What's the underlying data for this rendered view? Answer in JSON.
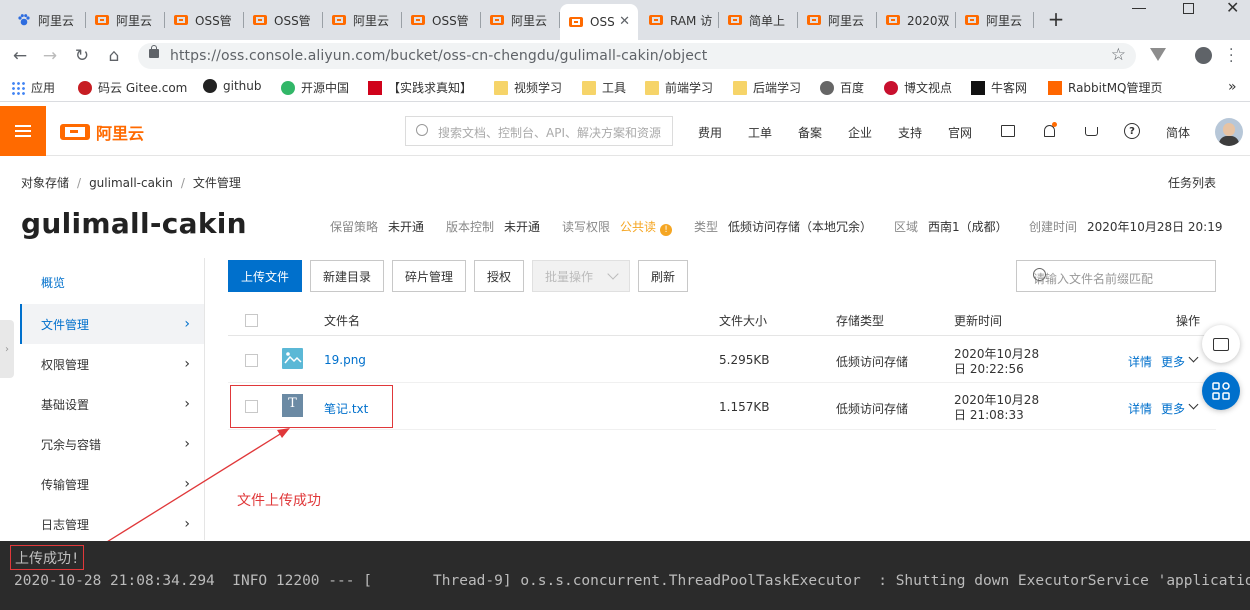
{
  "browser": {
    "tabs": [
      {
        "title": "阿里云",
        "icon": "paw-icon"
      },
      {
        "title": "阿里云",
        "icon": "aliyun-icon"
      },
      {
        "title": "OSS管",
        "icon": "aliyun-icon"
      },
      {
        "title": "OSS管",
        "icon": "aliyun-icon"
      },
      {
        "title": "阿里云",
        "icon": "aliyun-icon"
      },
      {
        "title": "OSS管",
        "icon": "aliyun-icon"
      },
      {
        "title": "阿里云",
        "icon": "aliyun-icon"
      },
      {
        "title": "OSS",
        "icon": "aliyun-icon",
        "active": true
      },
      {
        "title": "RAM 访",
        "icon": "aliyun-icon"
      },
      {
        "title": "简单上",
        "icon": "aliyun-icon"
      },
      {
        "title": "阿里云",
        "icon": "aliyun-icon"
      },
      {
        "title": "2020双",
        "icon": "aliyun-icon"
      },
      {
        "title": "阿里云",
        "icon": "aliyun-icon"
      }
    ],
    "new_tab": "+",
    "url": "https://oss.console.aliyun.com/bucket/oss-cn-chengdu/gulimall-cakin/object",
    "bookmarks": [
      {
        "label": "应用",
        "icon": "apps-icon"
      },
      {
        "label": "码云 Gitee.com",
        "icon": "gitee-icon"
      },
      {
        "label": "github",
        "icon": "github-icon"
      },
      {
        "label": "开源中国",
        "icon": "oschina-icon"
      },
      {
        "label": "【实践求真知】",
        "icon": "csdn-icon"
      },
      {
        "label": "视频学习",
        "icon": "folder-icon"
      },
      {
        "label": "工具",
        "icon": "folder-icon"
      },
      {
        "label": "前端学习",
        "icon": "folder-icon"
      },
      {
        "label": "后端学习",
        "icon": "folder-icon"
      },
      {
        "label": "百度",
        "icon": "globe-icon"
      },
      {
        "label": "博文视点",
        "icon": "broadview-icon"
      },
      {
        "label": "牛客网",
        "icon": "nowcoder-icon"
      },
      {
        "label": "RabbitMQ管理页",
        "icon": "rabbitmq-icon"
      }
    ],
    "more": "»"
  },
  "header": {
    "logo": "阿里云",
    "search_placeholder": "搜索文档、控制台、API、解决方案和资源",
    "nav": [
      "费用",
      "工单",
      "备案",
      "企业",
      "支持",
      "官网"
    ],
    "lang": "简体"
  },
  "breadcrumb": [
    "对象存储",
    "gulimall-cakin",
    "文件管理"
  ],
  "task_list": "任务列表",
  "bucket": {
    "name": "gulimall-cakin",
    "meta": [
      {
        "k": "保留策略",
        "v": "未开通"
      },
      {
        "k": "版本控制",
        "v": "未开通"
      },
      {
        "k": "读写权限",
        "v": "公共读"
      },
      {
        "k": "类型",
        "v": "低频访问存储（本地冗余）"
      },
      {
        "k": "区域",
        "v": "西南1（成都）"
      },
      {
        "k": "创建时间",
        "v": "2020年10月28日 20:19"
      }
    ]
  },
  "sidebar": {
    "items": [
      {
        "label": "概览"
      },
      {
        "label": "文件管理"
      },
      {
        "label": "权限管理"
      },
      {
        "label": "基础设置"
      },
      {
        "label": "冗余与容错"
      },
      {
        "label": "传输管理"
      },
      {
        "label": "日志管理"
      }
    ]
  },
  "toolbar": {
    "upload": "上传文件",
    "new_dir": "新建目录",
    "fragments": "碎片管理",
    "authorize": "授权",
    "batch": "批量操作",
    "refresh": "刷新",
    "search_placeholder": "请输入文件名前缀匹配"
  },
  "table": {
    "columns": [
      "文件名",
      "文件大小",
      "存储类型",
      "更新时间",
      "操作"
    ],
    "rows": [
      {
        "name": "19.png",
        "size": "5.295KB",
        "type": "低频访问存储",
        "date": "2020年10月28",
        "time": "日 20:22:56",
        "detail": "详情",
        "more": "更多"
      },
      {
        "name": "笔记.txt",
        "size": "1.157KB",
        "type": "低频访问存储",
        "date": "2020年10月28",
        "time": "日 21:08:33",
        "detail": "详情",
        "more": "更多"
      }
    ]
  },
  "annotation": "文件上传成功",
  "console": {
    "toast": "上传成功!",
    "log": "2020-10-28 21:08:34.294  INFO 12200 --- [       Thread-9] o.s.s.concurrent.ThreadPoolTaskExecutor  : Shutting down ExecutorService 'applicationTaskExecutor'"
  },
  "colors": {
    "brand": "#ff6a00",
    "primary": "#0070cc",
    "annotation": "#e0383a",
    "warning": "#f5a623"
  }
}
